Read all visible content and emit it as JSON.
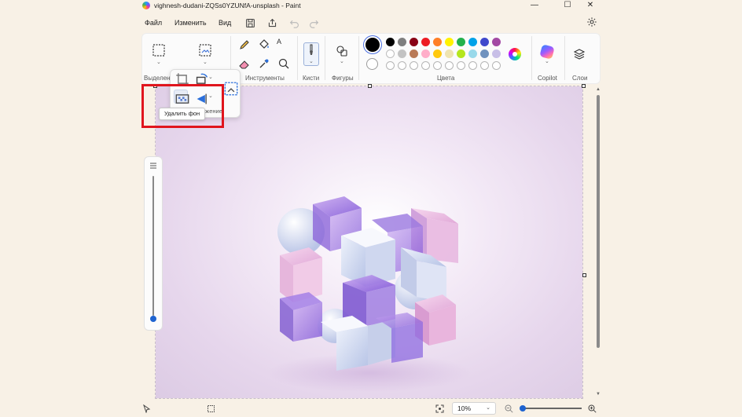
{
  "window": {
    "title": "vighnesh-dudani-ZQSs0YZUNfA-unsplash - Paint",
    "minimize": "—",
    "maximize": "☐",
    "close": "✕"
  },
  "menu": {
    "file": "Файл",
    "edit": "Изменить",
    "view": "Вид"
  },
  "ribbon": {
    "selection_label": "Выделени",
    "tools_label": "Инструменты",
    "brushes_label": "Кисти",
    "shapes_label": "Фигуры",
    "colors_label": "Цвета",
    "copilot_label": "Copilot",
    "layers_label": "Слои",
    "text_tool": "A"
  },
  "colors": {
    "primary": "#000000",
    "secondary": "#ffffff",
    "row1": [
      "#000000",
      "#7f7f7f",
      "#880015",
      "#ed1c24",
      "#ff7f27",
      "#fff200",
      "#22b14c",
      "#00a2e8",
      "#3f48cc",
      "#a349a4"
    ],
    "row2": [
      "#ffffff",
      "#c3c3c3",
      "#b97a57",
      "#ffaec9",
      "#ffc90e",
      "#efe4b0",
      "#b5e61d",
      "#99d9ea",
      "#7092be",
      "#c8bfe7"
    ],
    "row3_count_label": ""
  },
  "popup": {
    "tooltip": "Удалить фон",
    "trailing_text": "ажение"
  },
  "status": {
    "zoom": "10%"
  }
}
